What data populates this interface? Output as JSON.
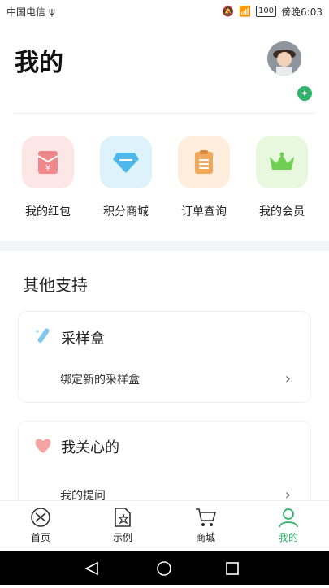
{
  "status": {
    "carrier": "中国电信",
    "battery": "100",
    "time_text": "傍晚6:03"
  },
  "header": {
    "title": "我的"
  },
  "quick_actions": [
    {
      "label": "我的红包",
      "icon": "red-envelope-icon"
    },
    {
      "label": "积分商城",
      "icon": "diamond-icon"
    },
    {
      "label": "订单查询",
      "icon": "clipboard-icon"
    },
    {
      "label": "我的会员",
      "icon": "crown-icon"
    }
  ],
  "support": {
    "title": "其他支持",
    "cards": [
      {
        "title": "采样盒",
        "icon": "test-tube-icon",
        "row": "绑定新的采样盒"
      },
      {
        "title": "我关心的",
        "icon": "heart-icon",
        "row": "我的提问"
      }
    ]
  },
  "tabs": [
    {
      "label": "首页",
      "icon": "dna-icon"
    },
    {
      "label": "示例",
      "icon": "document-star-icon"
    },
    {
      "label": "商城",
      "icon": "cart-icon"
    },
    {
      "label": "我的",
      "icon": "user-icon",
      "active": true
    }
  ],
  "colors": {
    "accent": "#2fb26a",
    "red_tint": "#fde6e6",
    "blue_tint": "#def2fb",
    "orange_tint": "#fdeede",
    "green_tint": "#e8f8df"
  }
}
